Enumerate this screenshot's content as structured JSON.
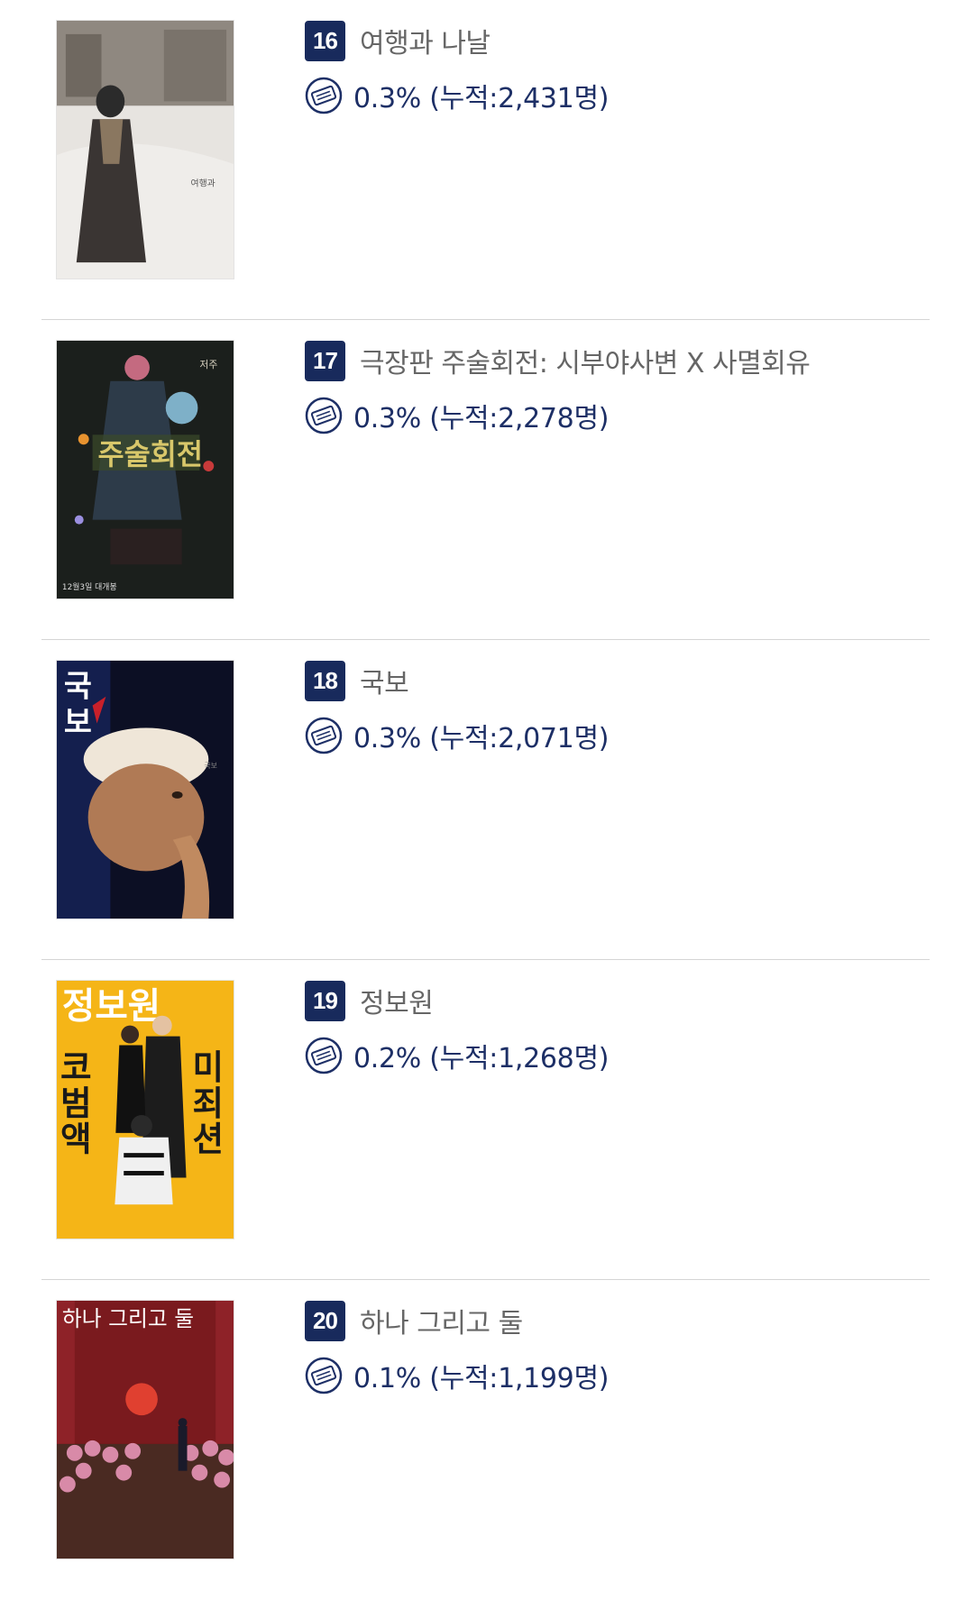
{
  "movies": [
    {
      "rank": "16",
      "title": "여행과 나날",
      "stat": "0.3% (누적:2,431명)",
      "poster_icon": "movie-poster-snowy-street"
    },
    {
      "rank": "17",
      "title": "극장판 주술회전: 시부야사변 X 사멸회유",
      "stat": "0.3% (누적:2,278명)",
      "poster_icon": "movie-poster-anime"
    },
    {
      "rank": "18",
      "title": "국보",
      "stat": "0.3% (누적:2,071명)",
      "poster_icon": "movie-poster-portrait"
    },
    {
      "rank": "19",
      "title": "정보원",
      "stat": "0.2% (누적:1,268명)",
      "poster_icon": "movie-poster-yellow-comedy"
    },
    {
      "rank": "20",
      "title": "하나 그리고 둘",
      "stat": "0.1% (누적:1,199명)",
      "poster_icon": "movie-poster-red-balloons"
    }
  ],
  "colors": {
    "rank_badge": "#182a5c",
    "stat_text": "#1d2f66",
    "title_text": "#666666",
    "divider": "#d5d5d5"
  },
  "stat_icon": "ticket-icon"
}
